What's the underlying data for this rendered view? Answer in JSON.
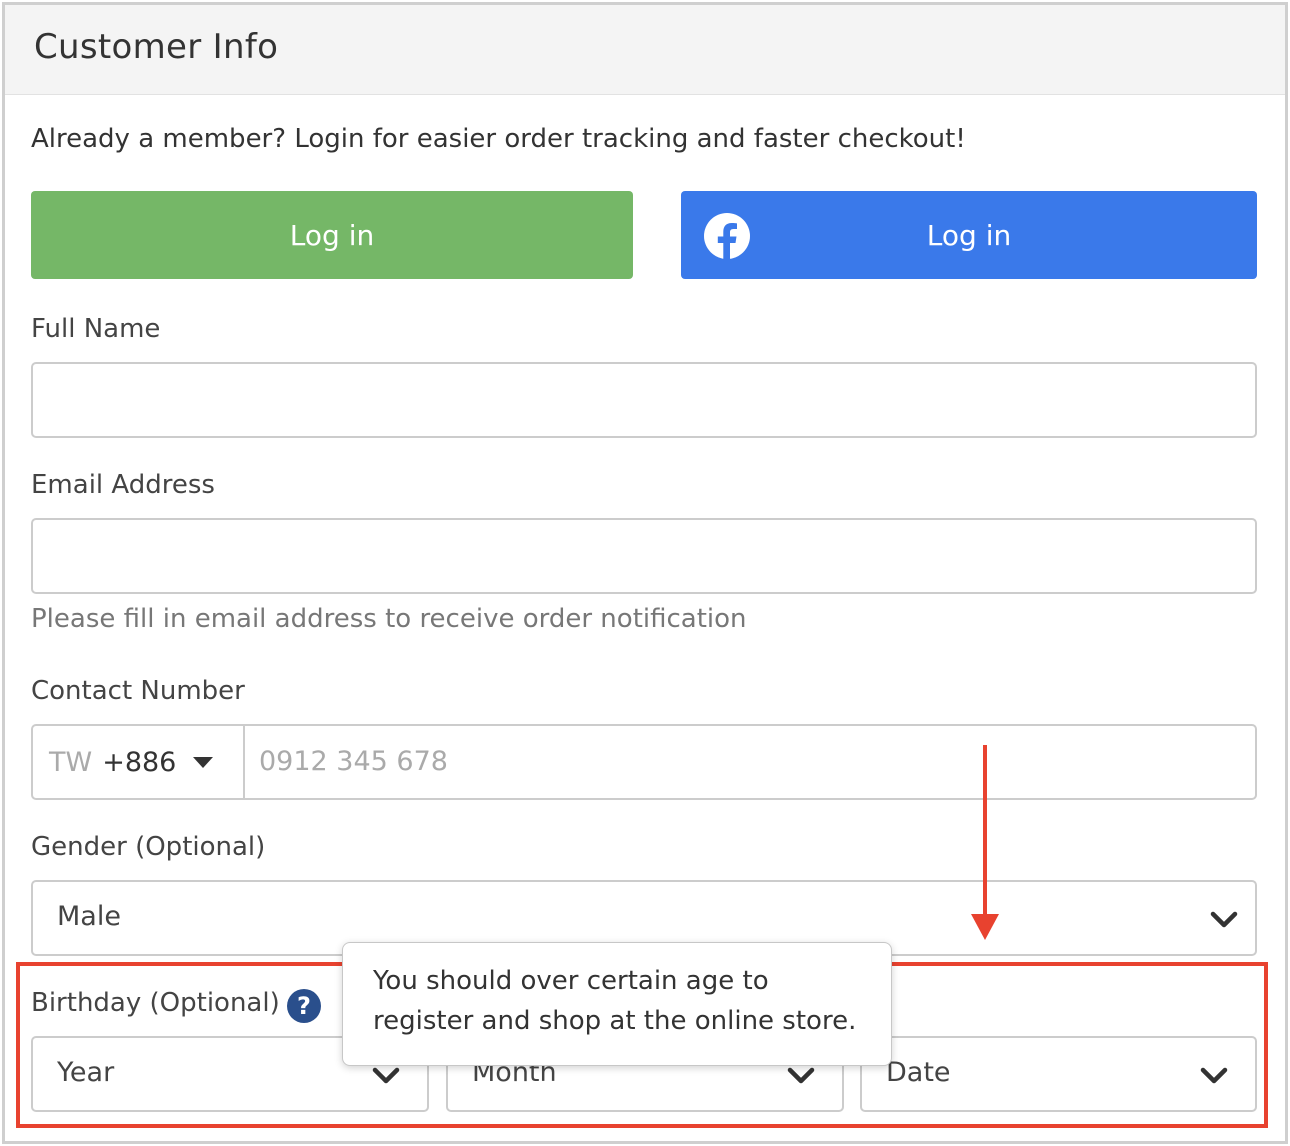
{
  "panel": {
    "title": "Customer Info"
  },
  "intro_text": "Already a member? Login for easier order tracking and faster checkout!",
  "login": {
    "email_button_label": "Log in",
    "facebook_button_label": "Log in",
    "email_button_color": "#75b767",
    "facebook_button_color": "#3a79ea",
    "facebook_icon": "facebook-icon"
  },
  "full_name": {
    "label": "Full Name",
    "value": "",
    "placeholder": ""
  },
  "email": {
    "label": "Email Address",
    "value": "",
    "placeholder": "",
    "help": "Please fill in email address to receive order notification"
  },
  "contact": {
    "label": "Contact Number",
    "country": "TW",
    "dial_code": "+886",
    "placeholder": "0912 345 678"
  },
  "gender": {
    "label": "Gender (Optional)",
    "selected": "Male"
  },
  "birthday": {
    "label": "Birthday (Optional)",
    "help_icon": "question-circle-icon",
    "year": "Year",
    "month": "Month",
    "date": "Date"
  },
  "tooltip": {
    "line1": "You should over certain age to",
    "line2": "register and shop at the online store."
  },
  "annotation": {
    "color": "#e8422f"
  }
}
